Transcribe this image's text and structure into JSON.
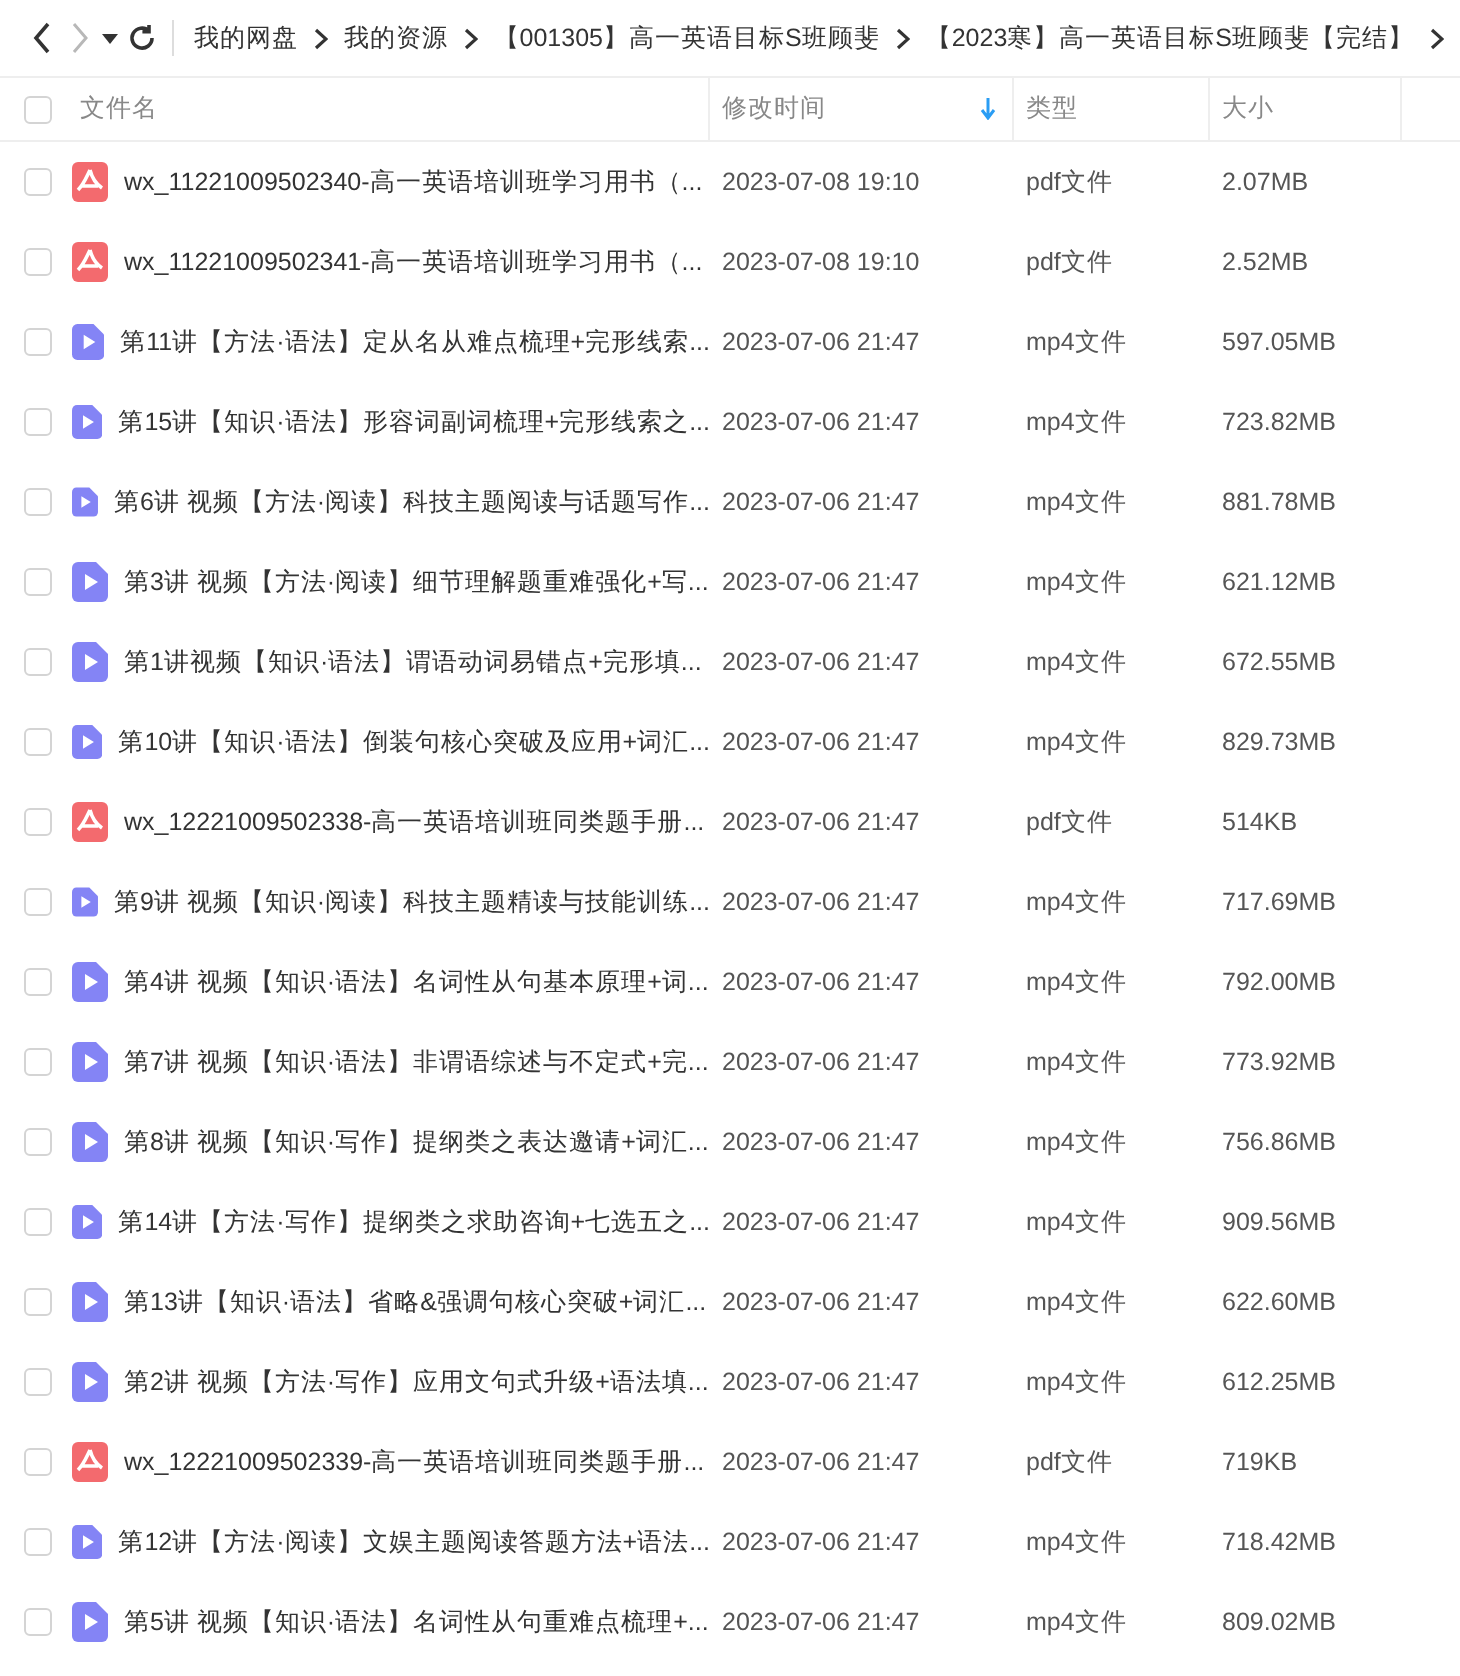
{
  "toolbar": {
    "breadcrumbs": [
      "我的网盘",
      "我的资源",
      "【001305】高一英语目标S班顾斐",
      "【2023寒】高一英语目标S班顾斐【完结】"
    ]
  },
  "table": {
    "select_all": {
      "checked": false
    },
    "columns": [
      {
        "label": "文件名",
        "sorted": false
      },
      {
        "label": "修改时间",
        "sorted": true
      },
      {
        "label": "类型",
        "sorted": false
      },
      {
        "label": "大小",
        "sorted": false
      }
    ],
    "rows": [
      {
        "checked": false,
        "kind": "pdf",
        "name": "wx_11221009502340-高一英语培训班学习用书（...",
        "modified": "2023-07-08 19:10",
        "type": "pdf文件",
        "size": "2.07MB"
      },
      {
        "checked": false,
        "kind": "pdf",
        "name": "wx_11221009502341-高一英语培训班学习用书（...",
        "modified": "2023-07-08 19:10",
        "type": "pdf文件",
        "size": "2.52MB"
      },
      {
        "checked": false,
        "kind": "video",
        "name": "第11讲【方法·语法】定从名从难点梳理+完形线索...",
        "modified": "2023-07-06 21:47",
        "type": "mp4文件",
        "size": "597.05MB"
      },
      {
        "checked": false,
        "kind": "video",
        "name": "第15讲【知识·语法】形容词副词梳理+完形线索之...",
        "modified": "2023-07-06 21:47",
        "type": "mp4文件",
        "size": "723.82MB"
      },
      {
        "checked": false,
        "kind": "video",
        "name": "第6讲 视频【方法·阅读】科技主题阅读与话题写作...",
        "modified": "2023-07-06 21:47",
        "type": "mp4文件",
        "size": "881.78MB"
      },
      {
        "checked": false,
        "kind": "video",
        "name": "第3讲 视频【方法·阅读】细节理解题重难强化+写...",
        "modified": "2023-07-06 21:47",
        "type": "mp4文件",
        "size": "621.12MB"
      },
      {
        "checked": false,
        "kind": "video",
        "name": "第1讲视频【知识·语法】谓语动词易错点+完形填...",
        "modified": "2023-07-06 21:47",
        "type": "mp4文件",
        "size": "672.55MB"
      },
      {
        "checked": false,
        "kind": "video",
        "name": "第10讲【知识·语法】倒装句核心突破及应用+词汇...",
        "modified": "2023-07-06 21:47",
        "type": "mp4文件",
        "size": "829.73MB"
      },
      {
        "checked": false,
        "kind": "pdf",
        "name": "wx_12221009502338-高一英语培训班同类题手册...",
        "modified": "2023-07-06 21:47",
        "type": "pdf文件",
        "size": "514KB"
      },
      {
        "checked": false,
        "kind": "video",
        "name": "第9讲 视频【知识·阅读】科技主题精读与技能训练...",
        "modified": "2023-07-06 21:47",
        "type": "mp4文件",
        "size": "717.69MB"
      },
      {
        "checked": false,
        "kind": "video",
        "name": "第4讲 视频【知识·语法】名词性从句基本原理+词...",
        "modified": "2023-07-06 21:47",
        "type": "mp4文件",
        "size": "792.00MB"
      },
      {
        "checked": false,
        "kind": "video",
        "name": "第7讲 视频【知识·语法】非谓语综述与不定式+完...",
        "modified": "2023-07-06 21:47",
        "type": "mp4文件",
        "size": "773.92MB"
      },
      {
        "checked": false,
        "kind": "video",
        "name": "第8讲 视频【知识·写作】提纲类之表达邀请+词汇...",
        "modified": "2023-07-06 21:47",
        "type": "mp4文件",
        "size": "756.86MB"
      },
      {
        "checked": false,
        "kind": "video",
        "name": "第14讲【方法·写作】提纲类之求助咨询+七选五之...",
        "modified": "2023-07-06 21:47",
        "type": "mp4文件",
        "size": "909.56MB"
      },
      {
        "checked": false,
        "kind": "video",
        "name": "第13讲【知识·语法】省略&强调句核心突破+词汇...",
        "modified": "2023-07-06 21:47",
        "type": "mp4文件",
        "size": "622.60MB"
      },
      {
        "checked": false,
        "kind": "video",
        "name": "第2讲 视频【方法·写作】应用文句式升级+语法填...",
        "modified": "2023-07-06 21:47",
        "type": "mp4文件",
        "size": "612.25MB"
      },
      {
        "checked": false,
        "kind": "pdf",
        "name": "wx_12221009502339-高一英语培训班同类题手册...",
        "modified": "2023-07-06 21:47",
        "type": "pdf文件",
        "size": "719KB"
      },
      {
        "checked": false,
        "kind": "video",
        "name": "第12讲【方法·阅读】文娱主题阅读答题方法+语法...",
        "modified": "2023-07-06 21:47",
        "type": "mp4文件",
        "size": "718.42MB"
      },
      {
        "checked": false,
        "kind": "video",
        "name": "第5讲 视频【知识·语法】名词性从句重难点梳理+...",
        "modified": "2023-07-06 21:47",
        "type": "mp4文件",
        "size": "809.02MB"
      }
    ]
  }
}
